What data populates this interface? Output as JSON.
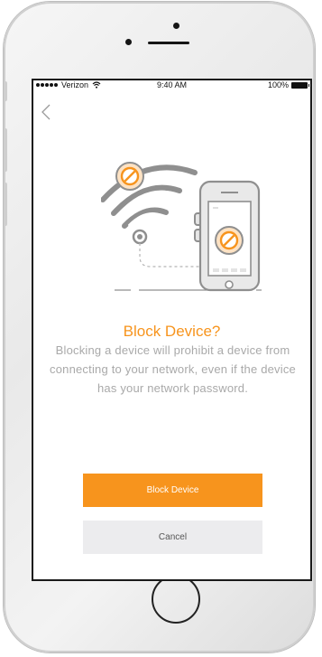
{
  "status_bar": {
    "carrier": "Verizon",
    "time": "9:40 AM",
    "battery": "100%"
  },
  "dialog": {
    "title": "Block Device?",
    "description": "Blocking a device will prohibit a device from connecting to your network, even if the device has your network password.",
    "primary_button": "Block Device",
    "secondary_button": "Cancel"
  },
  "colors": {
    "accent": "#f7941d",
    "text_muted": "#a9a9a9",
    "secondary_button_bg": "#ececee"
  },
  "icons": [
    "back-chevron-icon",
    "wifi-block-icon",
    "phone-block-icon"
  ]
}
